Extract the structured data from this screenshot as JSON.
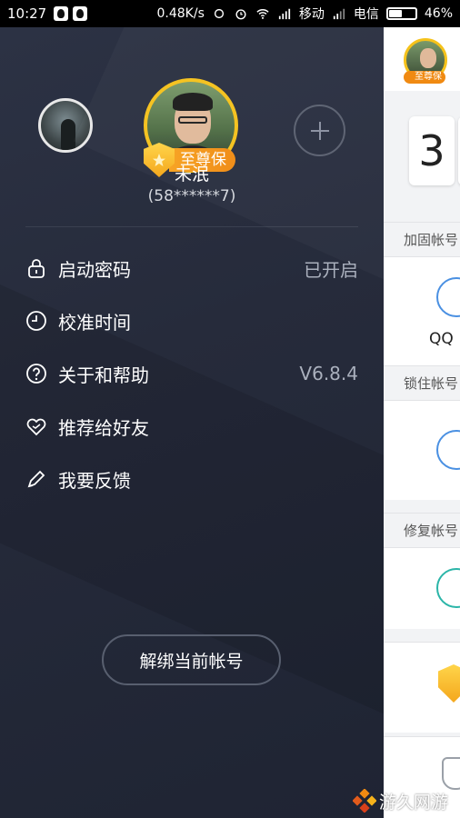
{
  "status_bar": {
    "time": "10:27",
    "speed": "0.48K/s",
    "carrier1": "移动",
    "carrier2": "电信",
    "battery": "46%",
    "battery_level": 0.46
  },
  "drawer": {
    "vip_label": "至尊保",
    "username": "未泯",
    "account": "(58******7)",
    "menu": [
      {
        "label": "启动密码",
        "value": "已开启",
        "icon": "lock-icon"
      },
      {
        "label": "校准时间",
        "value": "",
        "icon": "clock-icon"
      },
      {
        "label": "关于和帮助",
        "value": "V6.8.4",
        "icon": "help-icon"
      },
      {
        "label": "推荐给好友",
        "value": "",
        "icon": "heart-icon"
      },
      {
        "label": "我要反馈",
        "value": "",
        "icon": "pencil-icon"
      }
    ],
    "unbind_label": "解绑当前帐号"
  },
  "background_page": {
    "avatar_badge": "至尊保",
    "digit": "3",
    "sections": [
      "加固帐号",
      "锁住帐号",
      "修复帐号"
    ],
    "qq_label": "QQ",
    "accent": "#3e6fd8"
  },
  "watermark": "游久网游"
}
